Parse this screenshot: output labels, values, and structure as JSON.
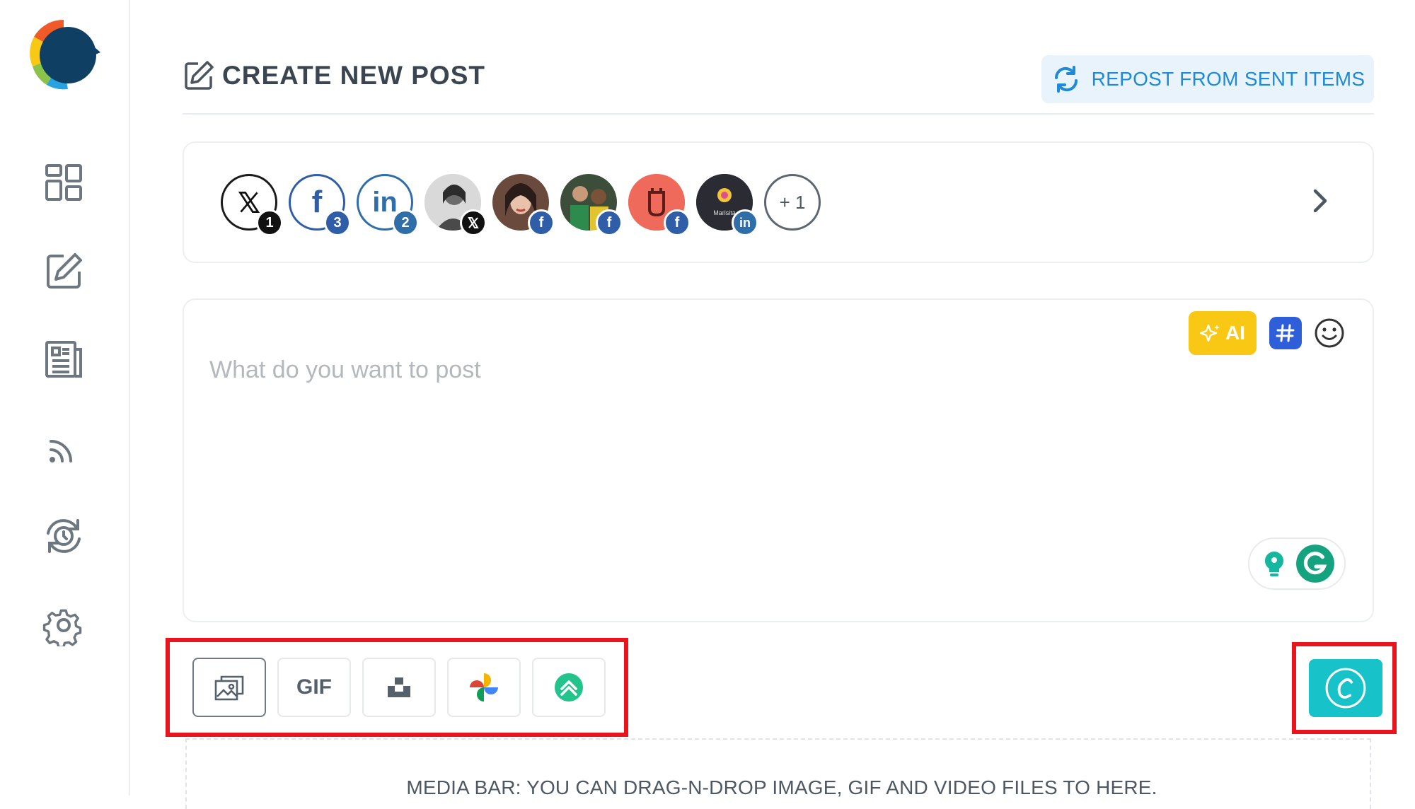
{
  "header": {
    "title": "CREATE NEW POST",
    "repost_label": "REPOST FROM SENT ITEMS"
  },
  "sidebar": {
    "items": [
      {
        "icon": "dashboard-icon"
      },
      {
        "icon": "compose-icon"
      },
      {
        "icon": "posts-list-icon"
      },
      {
        "icon": "rss-feed-icon"
      },
      {
        "icon": "history-icon"
      },
      {
        "icon": "settings-gear-icon"
      }
    ]
  },
  "accounts": {
    "items": [
      {
        "network": "x",
        "count": "1"
      },
      {
        "network": "facebook",
        "count": "3"
      },
      {
        "network": "linkedin",
        "count": "2"
      },
      {
        "network": "x-profile"
      },
      {
        "network": "facebook-profile"
      },
      {
        "network": "facebook-profile"
      },
      {
        "network": "facebook-page"
      },
      {
        "network": "linkedin-page",
        "avatar_text": "Marisita"
      }
    ],
    "more_label": "+ 1"
  },
  "composer": {
    "placeholder": "What do you want to post",
    "ai_label": "AI"
  },
  "media_bar": {
    "gif_label": "GIF",
    "drop_text": "MEDIA BAR: YOU CAN DRAG-N-DROP IMAGE, GIF AND VIDEO FILES TO HERE."
  },
  "colors": {
    "accent_blue": "#1f8ad8",
    "ai_yellow": "#f9c814",
    "canva_teal": "#17c3c8",
    "highlight_red": "#e8141e"
  }
}
